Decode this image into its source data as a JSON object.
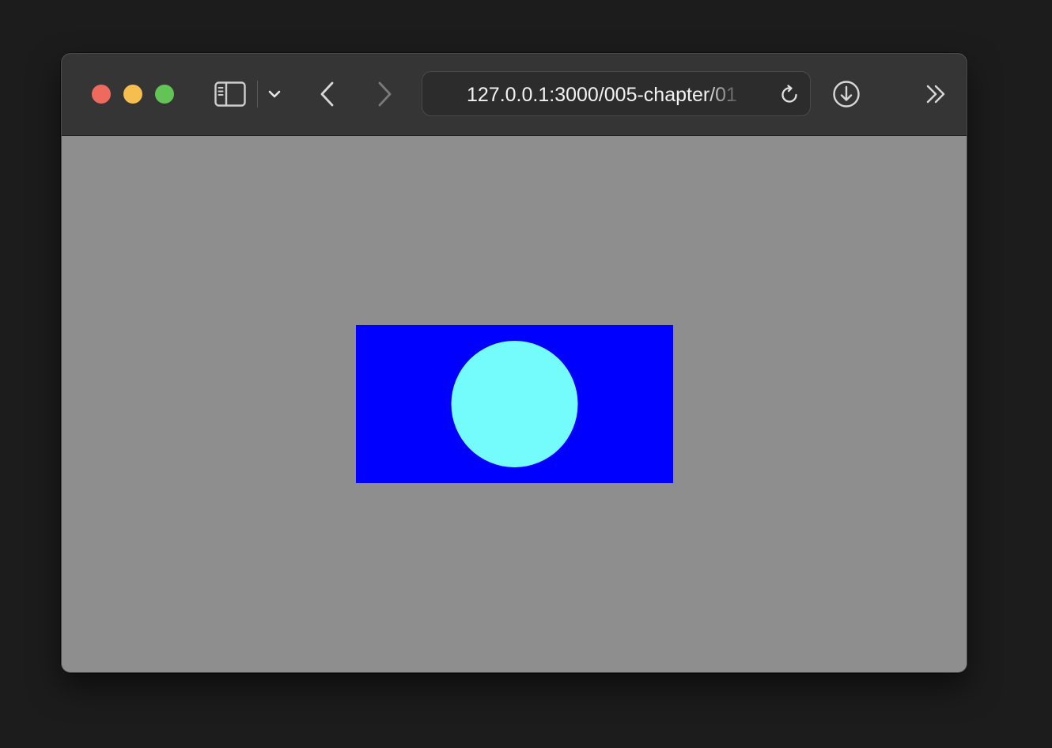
{
  "browser": {
    "address_bar": {
      "url": "127.0.0.1:3000/005-chapter/01"
    },
    "traffic_lights": {
      "close_color": "#ee6a5f",
      "minimize_color": "#f5be4f",
      "maximize_color": "#61c454"
    },
    "icons": {
      "sidebar": "sidebar-toggle-icon",
      "tab_group_menu": "chevron-down-icon",
      "back": "chevron-left-icon",
      "forward": "chevron-right-icon",
      "reload": "reload-icon",
      "downloads": "download-circle-icon",
      "overflow": "double-chevron-right-icon"
    }
  },
  "page": {
    "background_color": "#8e8e8e",
    "canvas": {
      "background_color": "#0000ff",
      "circle_color": "#74fcfc"
    }
  }
}
